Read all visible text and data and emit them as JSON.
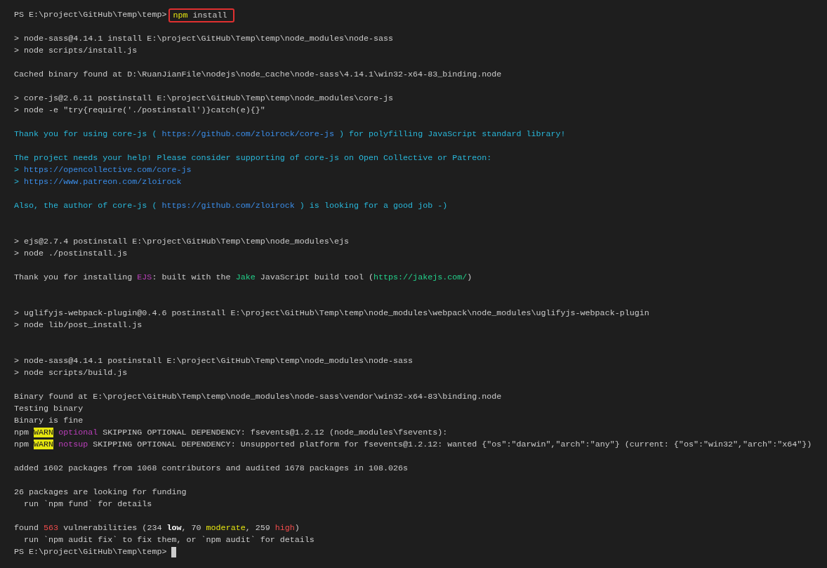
{
  "terminal": {
    "lines": [
      {
        "kind": "prompt",
        "prompt": "PS E:\\project\\GitHub\\Temp\\temp>",
        "command": [
          {
            "text": "npm",
            "kind": "yellow"
          },
          {
            "text": " install",
            "kind": "plain"
          }
        ],
        "highlighted": true,
        "cursor": false
      },
      {
        "kind": "blank"
      },
      {
        "kind": "output",
        "segments": [
          {
            "text": "> node-sass@4.14.1 install E:\\project\\GitHub\\Temp\\temp\\node_modules\\node-sass",
            "kind": "plain"
          }
        ]
      },
      {
        "kind": "output",
        "segments": [
          {
            "text": "> node scripts/install.js",
            "kind": "plain"
          }
        ]
      },
      {
        "kind": "blank"
      },
      {
        "kind": "output",
        "segments": [
          {
            "text": "Cached binary found at D:\\RuanJianFile\\nodejs\\node_cache\\node-sass\\4.14.1\\win32-x64-83_binding.node",
            "kind": "plain"
          }
        ]
      },
      {
        "kind": "blank"
      },
      {
        "kind": "output",
        "segments": [
          {
            "text": "> core-js@2.6.11 postinstall E:\\project\\GitHub\\Temp\\temp\\node_modules\\core-js",
            "kind": "plain"
          }
        ]
      },
      {
        "kind": "output",
        "segments": [
          {
            "text": "> node -e \"try{require('./postinstall')}catch(e){}\"",
            "kind": "plain"
          }
        ]
      },
      {
        "kind": "blank"
      },
      {
        "kind": "output",
        "segments": [
          {
            "text": "Thank you for using core-js ( ",
            "kind": "cyan"
          },
          {
            "text": "https://github.com/zloirock/core-js",
            "kind": "link"
          },
          {
            "text": " ) for polyfilling JavaScript standard library!",
            "kind": "cyan"
          }
        ]
      },
      {
        "kind": "blank"
      },
      {
        "kind": "output",
        "segments": [
          {
            "text": "The project needs your help! Please consider supporting of core-js on Open Collective or Patreon:",
            "kind": "cyan"
          }
        ]
      },
      {
        "kind": "output",
        "segments": [
          {
            "text": "> ",
            "kind": "cyan"
          },
          {
            "text": "https://opencollective.com/core-js",
            "kind": "link"
          }
        ]
      },
      {
        "kind": "output",
        "segments": [
          {
            "text": "> ",
            "kind": "cyan"
          },
          {
            "text": "https://www.patreon.com/zloirock",
            "kind": "link"
          }
        ]
      },
      {
        "kind": "blank"
      },
      {
        "kind": "output",
        "segments": [
          {
            "text": "Also, the author of core-js ( ",
            "kind": "cyan"
          },
          {
            "text": "https://github.com/zloirock",
            "kind": "link"
          },
          {
            "text": " ) is looking for a good job -)",
            "kind": "cyan"
          }
        ]
      },
      {
        "kind": "blank"
      },
      {
        "kind": "blank"
      },
      {
        "kind": "output",
        "segments": [
          {
            "text": "> ejs@2.7.4 postinstall E:\\project\\GitHub\\Temp\\temp\\node_modules\\ejs",
            "kind": "plain"
          }
        ]
      },
      {
        "kind": "output",
        "segments": [
          {
            "text": "> node ./postinstall.js",
            "kind": "plain"
          }
        ]
      },
      {
        "kind": "blank"
      },
      {
        "kind": "output",
        "segments": [
          {
            "text": "Thank you for installing ",
            "kind": "plain"
          },
          {
            "text": "EJS",
            "kind": "magenta"
          },
          {
            "text": ": built with the ",
            "kind": "plain"
          },
          {
            "text": "Jake",
            "kind": "green"
          },
          {
            "text": " JavaScript build tool (",
            "kind": "plain"
          },
          {
            "text": "https://jakejs.com/",
            "kind": "green"
          },
          {
            "text": ")",
            "kind": "plain"
          }
        ]
      },
      {
        "kind": "blank"
      },
      {
        "kind": "blank"
      },
      {
        "kind": "output",
        "segments": [
          {
            "text": "> uglifyjs-webpack-plugin@0.4.6 postinstall E:\\project\\GitHub\\Temp\\temp\\node_modules\\webpack\\node_modules\\uglifyjs-webpack-plugin",
            "kind": "plain"
          }
        ]
      },
      {
        "kind": "output",
        "segments": [
          {
            "text": "> node lib/post_install.js",
            "kind": "plain"
          }
        ]
      },
      {
        "kind": "blank"
      },
      {
        "kind": "blank"
      },
      {
        "kind": "output",
        "segments": [
          {
            "text": "> node-sass@4.14.1 postinstall E:\\project\\GitHub\\Temp\\temp\\node_modules\\node-sass",
            "kind": "plain"
          }
        ]
      },
      {
        "kind": "output",
        "segments": [
          {
            "text": "> node scripts/build.js",
            "kind": "plain"
          }
        ]
      },
      {
        "kind": "blank"
      },
      {
        "kind": "output",
        "segments": [
          {
            "text": "Binary found at E:\\project\\GitHub\\Temp\\temp\\node_modules\\node-sass\\vendor\\win32-x64-83\\binding.node",
            "kind": "plain"
          }
        ]
      },
      {
        "kind": "output",
        "segments": [
          {
            "text": "Testing binary",
            "kind": "plain"
          }
        ]
      },
      {
        "kind": "output",
        "segments": [
          {
            "text": "Binary is fine",
            "kind": "plain"
          }
        ]
      },
      {
        "kind": "output",
        "segments": [
          {
            "text": "npm ",
            "kind": "plain"
          },
          {
            "text": "WARN",
            "kind": "warn"
          },
          {
            "text": " optional",
            "kind": "magenta"
          },
          {
            "text": " SKIPPING OPTIONAL DEPENDENCY: fsevents@1.2.12 (node_modules\\fsevents):",
            "kind": "plain"
          }
        ]
      },
      {
        "kind": "output",
        "segments": [
          {
            "text": "npm ",
            "kind": "plain"
          },
          {
            "text": "WARN",
            "kind": "warn"
          },
          {
            "text": " notsup",
            "kind": "magenta"
          },
          {
            "text": " SKIPPING OPTIONAL DEPENDENCY: Unsupported platform for fsevents@1.2.12: wanted {\"os\":\"darwin\",\"arch\":\"any\"} (current: {\"os\":\"win32\",\"arch\":\"x64\"})",
            "kind": "plain"
          }
        ]
      },
      {
        "kind": "blank"
      },
      {
        "kind": "output",
        "segments": [
          {
            "text": "added 1602 packages from 1068 contributors and audited 1678 packages in 108.026s",
            "kind": "plain"
          }
        ]
      },
      {
        "kind": "blank"
      },
      {
        "kind": "output",
        "segments": [
          {
            "text": "26 packages are looking for funding",
            "kind": "plain"
          }
        ]
      },
      {
        "kind": "output",
        "segments": [
          {
            "text": "  run `npm fund` for details",
            "kind": "plain"
          }
        ]
      },
      {
        "kind": "blank"
      },
      {
        "kind": "output",
        "segments": [
          {
            "text": "found ",
            "kind": "plain"
          },
          {
            "text": "563",
            "kind": "red"
          },
          {
            "text": " vulnerabilities (234 ",
            "kind": "plain"
          },
          {
            "text": "low",
            "kind": "bold"
          },
          {
            "text": ", 70 ",
            "kind": "plain"
          },
          {
            "text": "moderate",
            "kind": "yellow"
          },
          {
            "text": ", 259 ",
            "kind": "plain"
          },
          {
            "text": "high",
            "kind": "red"
          },
          {
            "text": ")",
            "kind": "plain"
          }
        ]
      },
      {
        "kind": "output",
        "segments": [
          {
            "text": "  run `npm audit fix` to fix them, or `npm audit` for details",
            "kind": "plain"
          }
        ]
      },
      {
        "kind": "prompt",
        "prompt": "PS E:\\project\\GitHub\\Temp\\temp>",
        "cursor": true
      }
    ]
  }
}
